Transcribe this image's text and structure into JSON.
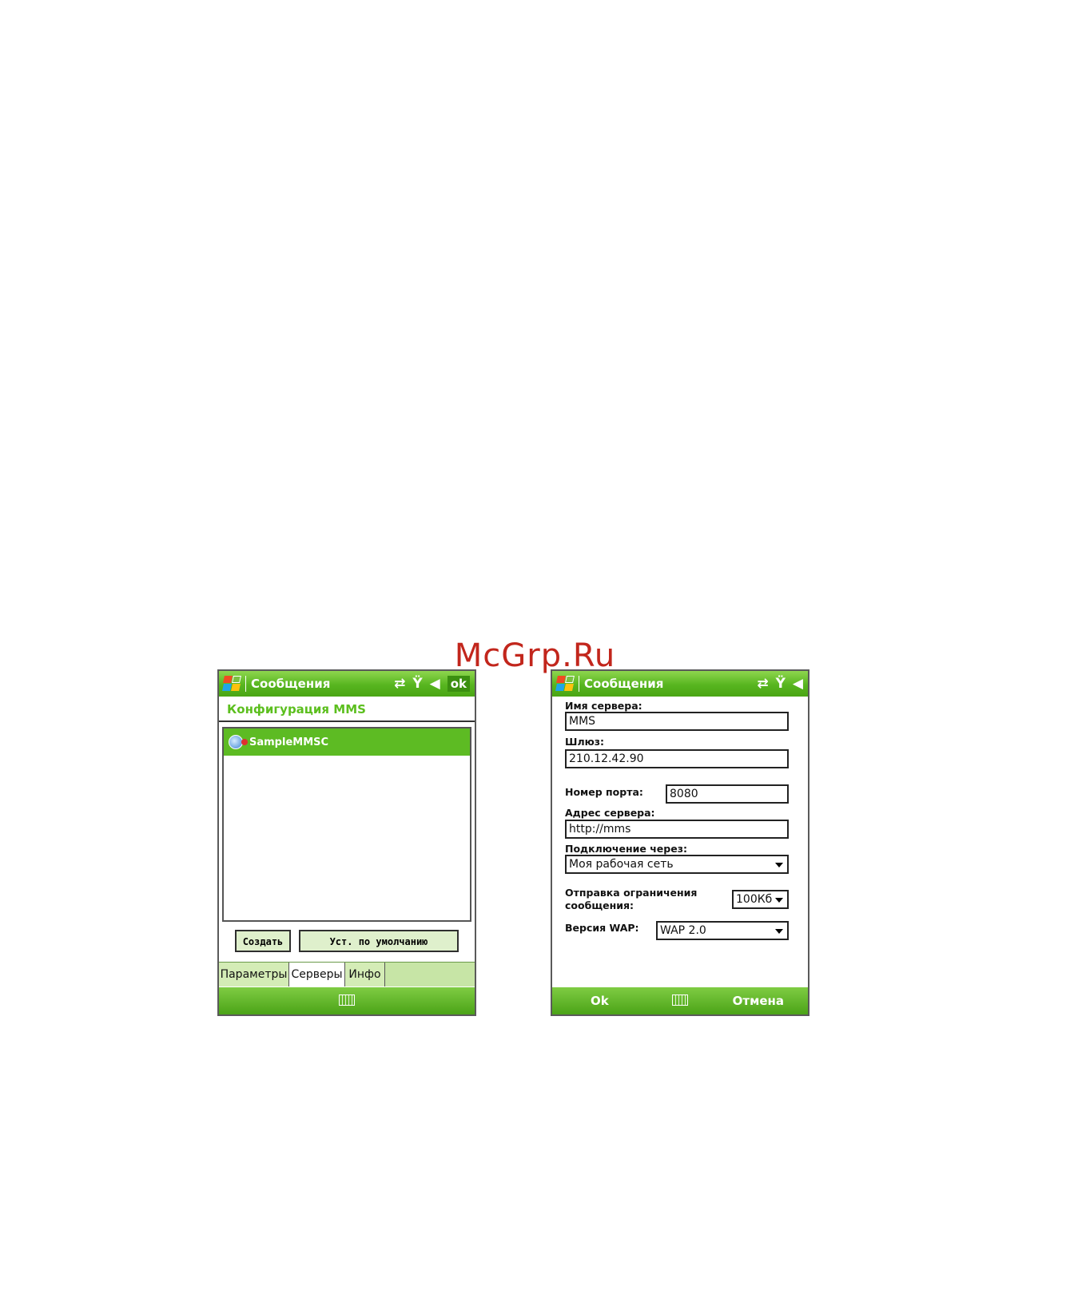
{
  "watermark": "McGrp.Ru",
  "left_screen": {
    "title": "Сообщения",
    "ok_label": "ok",
    "subtitle": "Конфигурация MMS",
    "servers": [
      "SampleMMSC"
    ],
    "buttons": {
      "create": "Создать",
      "set_default": "Уст. по умолчанию"
    },
    "tabs": [
      "Параметры",
      "Серверы",
      "Инфо"
    ],
    "active_tab": "Серверы"
  },
  "right_screen": {
    "title": "Сообщения",
    "fields": {
      "server_name_label": "Имя сервера:",
      "server_name_value": "MMS",
      "gateway_label": "Шлюз:",
      "gateway_value": "210.12.42.90",
      "port_label": "Номер порта:",
      "port_value": "8080",
      "server_address_label": "Адрес сервера:",
      "server_address_value": "http://mms",
      "connect_via_label": "Подключение через:",
      "connect_via_value": "Моя рабочая сеть",
      "send_limit_label_line1": "Отправка ограничения",
      "send_limit_label_line2": "сообщения:",
      "send_limit_value": "100Кб",
      "wap_version_label": "Версия WAP:",
      "wap_version_value": "WAP 2.0"
    },
    "softkeys": {
      "left": "Ok",
      "right": "Отмена"
    }
  },
  "icons": {
    "start": "windows-flag-icon",
    "connectivity": "sync-arrows-icon",
    "signal": "signal-strength-icon",
    "volume": "volume-icon",
    "keyboard": "keyboard-icon",
    "server": "globe-server-icon"
  }
}
